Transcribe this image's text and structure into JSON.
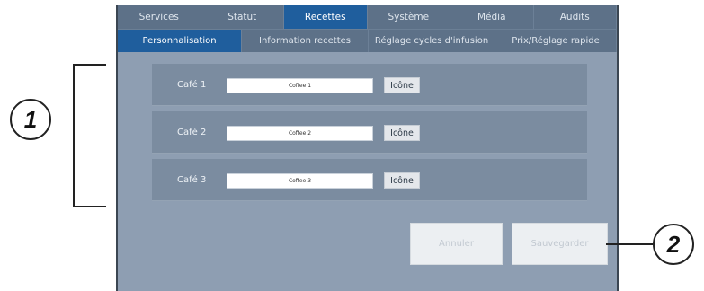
{
  "tabs_primary": [
    {
      "label": "Services",
      "active": false
    },
    {
      "label": "Statut",
      "active": false
    },
    {
      "label": "Recettes",
      "active": true
    },
    {
      "label": "Système",
      "active": false
    },
    {
      "label": "Média",
      "active": false
    },
    {
      "label": "Audits",
      "active": false
    }
  ],
  "tabs_secondary": [
    {
      "label": "Personnalisation",
      "active": true
    },
    {
      "label": "Information recettes",
      "active": false
    },
    {
      "label": "Réglage cycles d'infusion",
      "active": false
    },
    {
      "label": "Prix/Réglage rapide",
      "active": false
    }
  ],
  "coffees": [
    {
      "label": "Café 1",
      "value": "Coffee 1",
      "icon_button": "Icône"
    },
    {
      "label": "Café 2",
      "value": "Coffee 2",
      "icon_button": "Icône"
    },
    {
      "label": "Café 3",
      "value": "Coffee 3",
      "icon_button": "Icône"
    }
  ],
  "actions": {
    "cancel": "Annuler",
    "save": "Sauvegarder"
  },
  "callouts": {
    "first": "1",
    "second": "2"
  },
  "colors": {
    "active_tab": "#1f5e9d",
    "tab_bar": "#5d7188",
    "panel": "#8e9eb2"
  }
}
